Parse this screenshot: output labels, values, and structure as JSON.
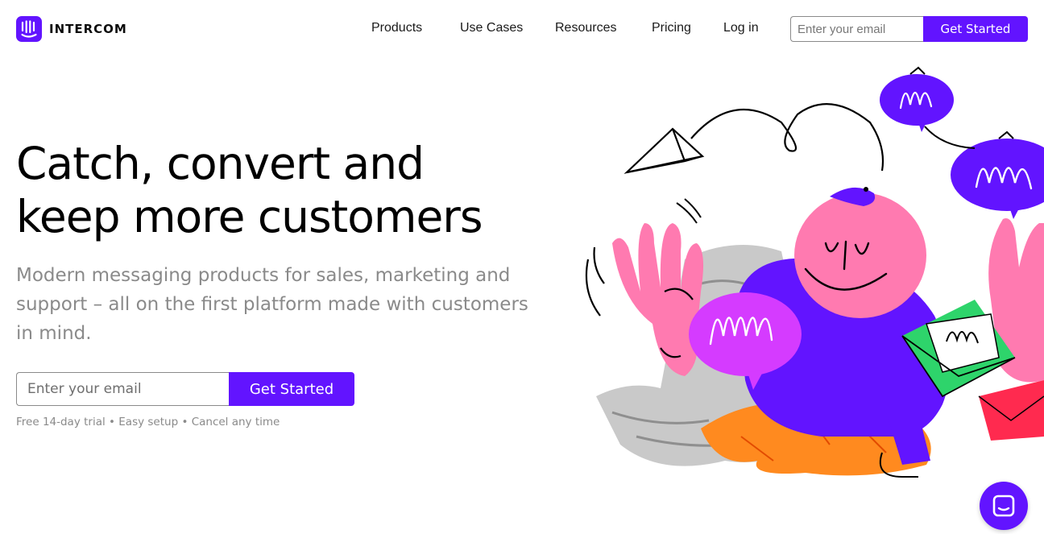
{
  "brand": {
    "name": "INTERCOM",
    "logo_icon": "intercom-logo-icon",
    "accent": "#6214ff"
  },
  "nav": {
    "links": [
      "Products",
      "Use Cases",
      "Resources",
      "Pricing",
      "Log in"
    ],
    "email_placeholder": "Enter your email",
    "cta_label": "Get Started"
  },
  "hero": {
    "title_line1": "Catch, convert and",
    "title_line2": "keep more customers",
    "subtitle": "Modern messaging products for sales, marketing and support – all on the first platform made with customers in mind.",
    "email_placeholder": "Enter your email",
    "cta_label": "Get Started",
    "perks": "Free 14-day trial  •  Easy setup  •  Cancel any time"
  },
  "illustration": {
    "icon": "hero-illustration",
    "colors": {
      "purple": "#6214ff",
      "pink": "#ff7ab0",
      "magenta": "#d53bff",
      "orange": "#ff8a1f",
      "green": "#2ed46b",
      "red": "#ff2a4f"
    }
  },
  "messenger": {
    "icon": "messenger-launcher-icon"
  }
}
